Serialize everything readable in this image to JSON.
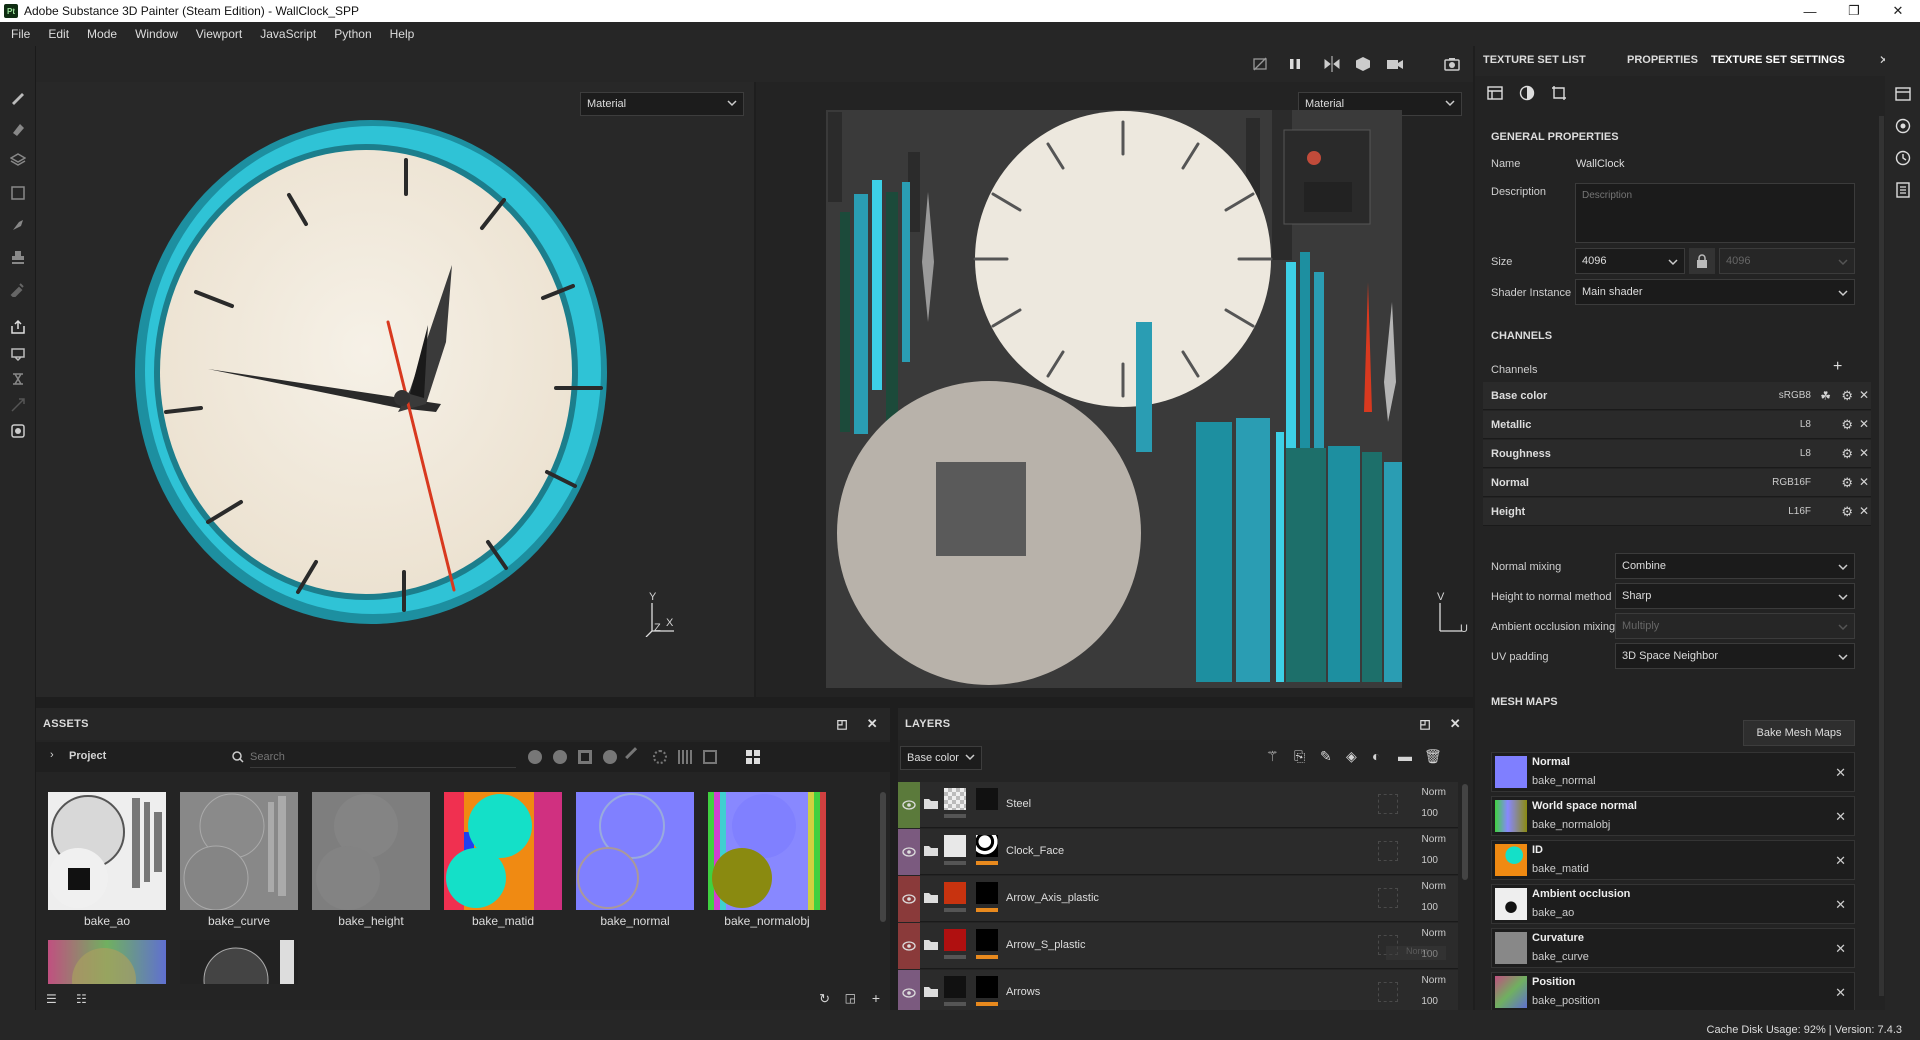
{
  "titlebar": {
    "logo": "Pt",
    "title": "Adobe Substance 3D Painter (Steam Edition) - WallClock_SPP",
    "minimize": "—",
    "maximize": "❐",
    "close": "✕"
  },
  "menu": [
    "File",
    "Edit",
    "Mode",
    "Window",
    "Viewport",
    "JavaScript",
    "Python",
    "Help"
  ],
  "viewport3d": {
    "material_select": "Material",
    "axis_y": "Y",
    "axis_z": "Z",
    "axis_x": "X"
  },
  "viewport2d": {
    "material_select": "Material",
    "axis_v": "V",
    "axis_u": "U"
  },
  "assets": {
    "title": "ASSETS",
    "project_label": "Project",
    "search_placeholder": "Search",
    "items": [
      {
        "label": "bake_ao"
      },
      {
        "label": "bake_curve"
      },
      {
        "label": "bake_height"
      },
      {
        "label": "bake_matid"
      },
      {
        "label": "bake_normal"
      },
      {
        "label": "bake_normalobj"
      }
    ]
  },
  "layers": {
    "title": "LAYERS",
    "channel_select": "Base color",
    "items": [
      {
        "name": "Steel",
        "blend": "Norm",
        "opacity": "100",
        "color": "#5b7a3b"
      },
      {
        "name": "Clock_Face",
        "blend": "Norm",
        "opacity": "100",
        "color": "#7b5a7f"
      },
      {
        "name": "Arrow_Axis_plastic",
        "blend": "Norm",
        "opacity": "100",
        "color": "#8a3a3a"
      },
      {
        "name": "Arrow_S_plastic",
        "blend": "Norm",
        "opacity": "100",
        "color": "#8a3a3a"
      },
      {
        "name": "Arrows",
        "blend": "Norm",
        "opacity": "100",
        "color": "#7b5a7f"
      }
    ],
    "ghost_text": "Norm"
  },
  "rightpanel": {
    "tabs": [
      "TEXTURE SET LIST",
      "PROPERTIES",
      "TEXTURE SET SETTINGS"
    ],
    "tab_close": "✕",
    "general_title": "GENERAL PROPERTIES",
    "name_label": "Name",
    "name_value": "WallClock",
    "description_label": "Description",
    "description_placeholder": "Description",
    "size_label": "Size",
    "size_value": "4096",
    "size_value2": "4096",
    "shader_label": "Shader Instance",
    "shader_value": "Main shader",
    "channels_title": "CHANNELS",
    "channels_label": "Channels",
    "add": "+",
    "channels": [
      {
        "name": "Base color",
        "format": "sRGB8"
      },
      {
        "name": "Metallic",
        "format": "L8"
      },
      {
        "name": "Roughness",
        "format": "L8"
      },
      {
        "name": "Normal",
        "format": "RGB16F"
      },
      {
        "name": "Height",
        "format": "L16F"
      }
    ],
    "normal_mixing_label": "Normal mixing",
    "normal_mixing_value": "Combine",
    "h2n_label": "Height to normal method",
    "h2n_value": "Sharp",
    "ao_mixing_label": "Ambient occlusion mixing",
    "ao_mixing_value": "Multiply",
    "uv_padding_label": "UV padding",
    "uv_padding_value": "3D Space Neighbor",
    "meshmaps_title": "MESH MAPS",
    "bake_button": "Bake Mesh Maps",
    "meshmaps": [
      {
        "title": "Normal",
        "file": "bake_normal"
      },
      {
        "title": "World space normal",
        "file": "bake_normalobj"
      },
      {
        "title": "ID",
        "file": "bake_matid"
      },
      {
        "title": "Ambient occlusion",
        "file": "bake_ao"
      },
      {
        "title": "Curvature",
        "file": "bake_curve"
      },
      {
        "title": "Position",
        "file": "bake_position"
      }
    ]
  },
  "status": {
    "text": "Cache Disk Usage:   92% | Version: 7.4.3"
  }
}
